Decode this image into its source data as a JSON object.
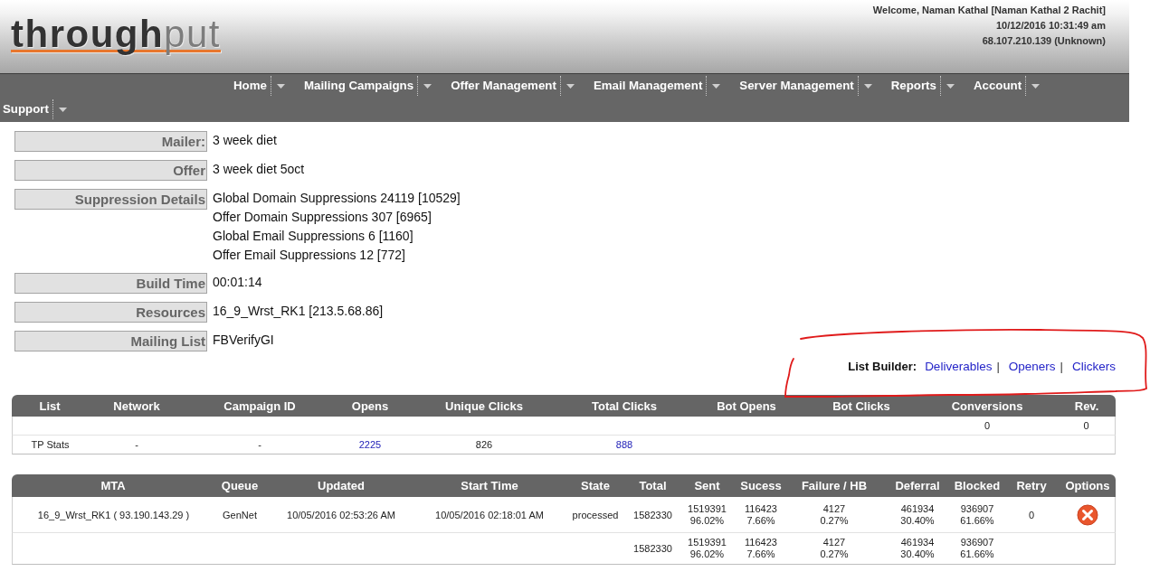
{
  "header": {
    "logo": "**through**put",
    "user": {
      "welcome": "Welcome, Naman Kathal [Naman Kathal 2 Rachit]",
      "datetime": "10/12/2016 10:31:49 am",
      "ip": "68.107.210.139 (Unknown)"
    }
  },
  "nav": {
    "items": [
      {
        "label": "Home"
      },
      {
        "label": "Mailing Campaigns"
      },
      {
        "label": "Offer Management"
      },
      {
        "label": "Email Management"
      },
      {
        "label": "Server Management"
      },
      {
        "label": "Reports"
      },
      {
        "label": "Account"
      },
      {
        "label": "Support"
      }
    ]
  },
  "details": [
    {
      "label": "Mailer:",
      "values": [
        "3 week diet"
      ]
    },
    {
      "label": "Offer",
      "values": [
        "3 week diet 5oct"
      ]
    },
    {
      "label": "Suppression Details",
      "values": [
        "Global Domain Suppressions 24119 [10529]",
        "Offer Domain Suppressions 307 [6965]",
        "Global Email Suppressions 6 [1160]",
        "Offer Email Suppressions 12 [772]"
      ]
    },
    {
      "label": "Build Time",
      "values": [
        "00:01:14"
      ]
    },
    {
      "label": "Resources",
      "values": [
        "16_9_Wrst_RK1 [213.5.68.86]"
      ]
    },
    {
      "label": "Mailing List",
      "values": [
        "FBVerifyGI"
      ]
    }
  ],
  "list_builder": {
    "label": "List Builder:",
    "links": [
      {
        "text": "Deliverables",
        "separator": "|"
      },
      {
        "text": "Openers",
        "separator": "|"
      },
      {
        "text": "Clickers"
      }
    ]
  },
  "annotation": {
    "kind": "freehand_loop"
  },
  "stats_table": {
    "columns": [
      "List",
      "Network",
      "Campaign ID",
      "Opens",
      "Unique Clicks",
      "Total Clicks",
      "Bot Opens",
      "Bot Clicks",
      "Conversions",
      "Rev."
    ],
    "rows": [
      {
        "conversions": "0",
        "rev": "0"
      },
      {
        "list": "TP Stats",
        "network": "-",
        "campaign_id": "-",
        "opens": {
          "text": "2225",
          "link": true
        },
        "unique_clicks": "826",
        "total_clicks": {
          "text": "888",
          "link": true
        }
      }
    ]
  },
  "mta_table": {
    "columns": [
      "MTA",
      "Queue",
      "Updated",
      "Start Time",
      "State",
      "Total",
      "Sent",
      "Sucess",
      "Failure / HB",
      "Deferral",
      "Blocked",
      "Retry",
      "Options"
    ],
    "rows": [
      {
        "mta": "16_9_Wrst_RK1 ( 93.190.143.29 )",
        "queue": "GenNet",
        "updated": "10/05/2016 02:53:26 AM",
        "start_time": "10/05/2016 02:18:01 AM",
        "state": "processed",
        "total": "1582330",
        "sent": {
          "count": "1519391",
          "percent": "96.02%"
        },
        "success": {
          "count": "116423",
          "percent": "7.66%"
        },
        "failure_hb": {
          "count": "4127",
          "percent": "0.27%"
        },
        "deferral": {
          "count": "461934",
          "percent": "30.40%"
        },
        "blocked": {
          "count": "936907",
          "percent": "61.66%"
        },
        "retry": "0",
        "remove_button": true
      },
      {
        "total": "1582330",
        "sent": {
          "count": "1519391",
          "percent": "96.02%"
        },
        "success": {
          "count": "116423",
          "percent": "7.66%"
        },
        "failure_hb": {
          "count": "4127",
          "percent": "0.27%"
        },
        "deferral": {
          "count": "461934",
          "percent": "30.40%"
        },
        "blocked": {
          "count": "936907",
          "percent": "61.66%"
        },
        "remove_button": false
      }
    ]
  }
}
